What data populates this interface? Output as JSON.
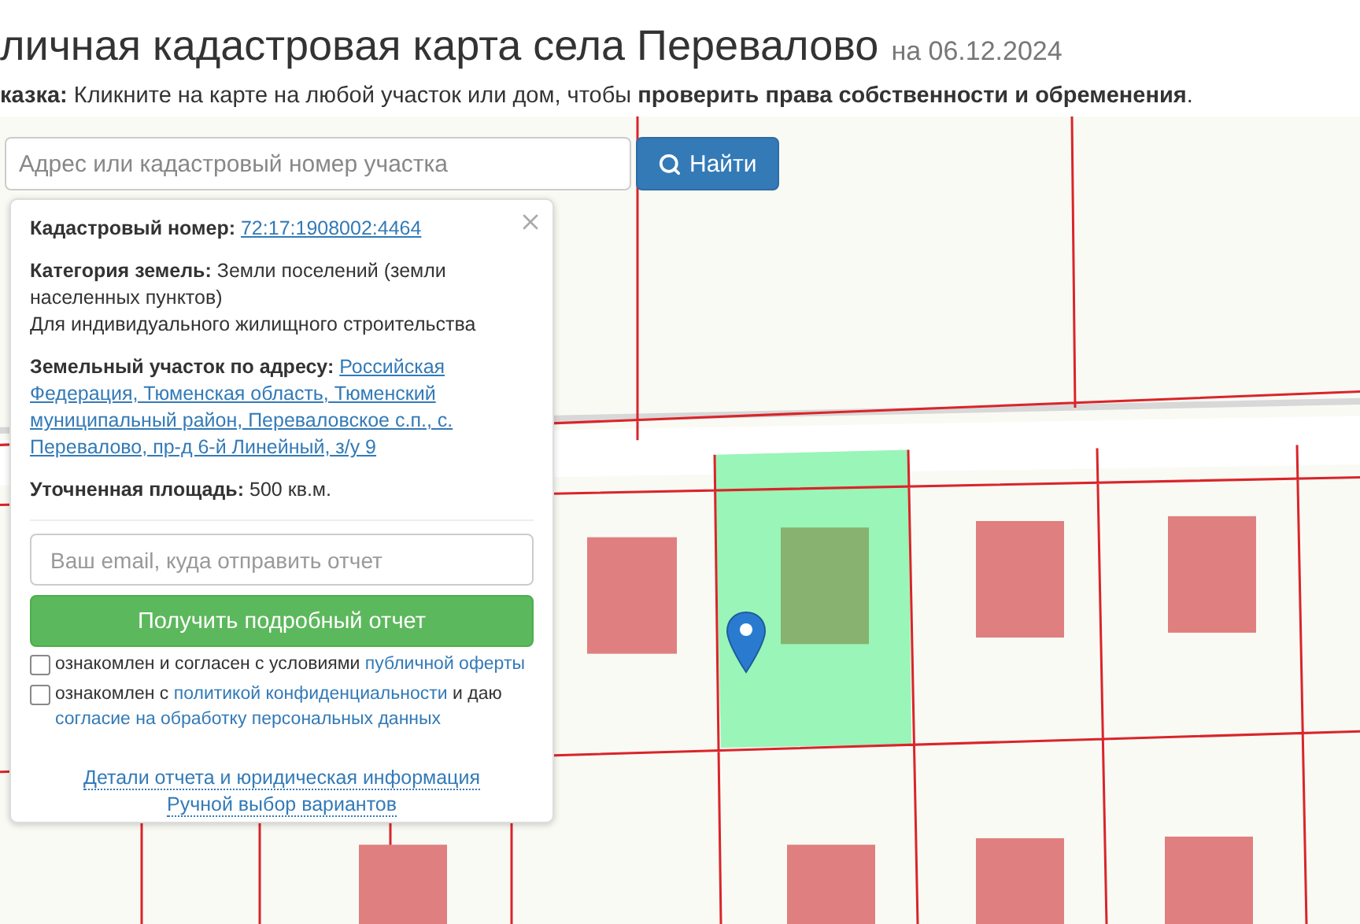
{
  "header": {
    "title": "личная кадастровая карта села Перевалово",
    "date": "на 06.12.2024",
    "hint": "**казка:** Кликните на карте на любой участок или дом, чтобы **проверить права собственности и обременения**."
  },
  "search": {
    "placeholder": "Адрес или кадастровый номер участка",
    "button": "Найти"
  },
  "popup": {
    "cadastral_label": "Кадастровый номер:",
    "cadastral_number": "72:17:1908002:4464",
    "category_label": "Категория земель:",
    "category": "Земли поселений (земли населенных пунктов)",
    "usage": "Для индивидуального жилищного строительства",
    "address_label": "Земельный участок по адресу:",
    "address_lines": [
      "Российская",
      "Федерация, Тюменская область, Тюменский",
      "муниципальный район, Переваловское с.п., с.",
      "Перевалово, пр-д 6-й Линейный, з/у 9"
    ],
    "area_label": "Уточненная площадь:",
    "area": "500 кв.м.",
    "email_placeholder": "Ваш email, куда отправить отчет",
    "submit": "Получить подробный отчет",
    "consents": [
      {
        "checked": false,
        "parts": [
          {
            "kind": "text",
            "text": "ознакомлен и согласен с условиями"
          },
          {
            "kind": "link",
            "text": "публичной оферты"
          }
        ]
      },
      {
        "checked": false,
        "parts": [
          {
            "kind": "text",
            "text": "ознакомлен с"
          },
          {
            "kind": "link",
            "text": "политикой конфиденциальности"
          },
          {
            "kind": "text",
            "text": "и даю"
          },
          {
            "kind": "link",
            "text": "согласие на обработку персональных данных"
          }
        ]
      }
    ],
    "footer_links": [
      "Детали отчета и юридическая информация",
      "Ручной выбор вариантов"
    ]
  }
}
